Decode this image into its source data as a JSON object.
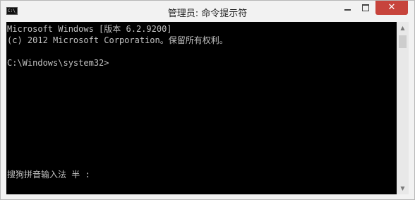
{
  "window": {
    "title": "管理员: 命令提示符",
    "icon_label": "C:\\_"
  },
  "controls": {
    "minimize_icon": "minimize-icon",
    "maximize_icon": "maximize-icon",
    "close_glyph": "✕"
  },
  "console": {
    "lines": [
      "Microsoft Windows [版本 6.2.9200]",
      "(c) 2012 Microsoft Corporation。保留所有权利。",
      "C:\\Windows\\system32>"
    ],
    "ime_status": "搜狗拼音输入法 半 :"
  },
  "colors": {
    "console_bg": "#000000",
    "console_fg": "#c0c0c0",
    "close_button": "#c7443c",
    "titlebar": "#f2f2f2"
  }
}
